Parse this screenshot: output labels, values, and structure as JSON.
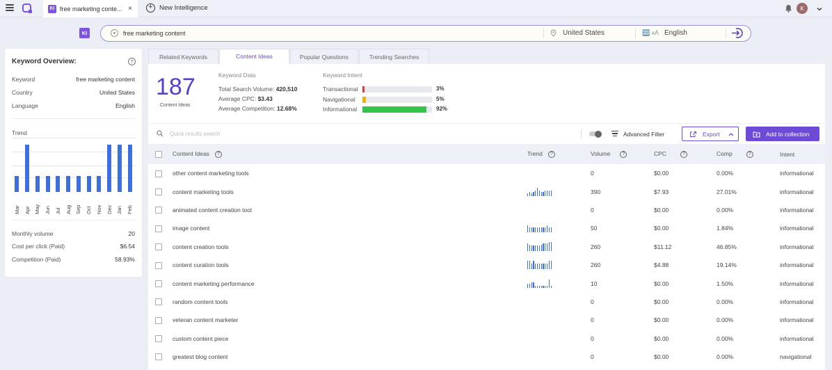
{
  "topbar": {
    "tab_badge": "KI",
    "tab_title": "free marketing conte...",
    "tab_close": "×",
    "new_tab_label": "New Intelligence",
    "avatar_letter": "K"
  },
  "search": {
    "badge": "KI",
    "query": "free marketing content",
    "country": "United States",
    "language": "English"
  },
  "overview": {
    "title": "Keyword Overview:",
    "help": "?",
    "keyword_label": "Keyword",
    "keyword_value": "free marketing content",
    "country_label": "Country",
    "country_value": "United States",
    "language_label": "Language",
    "language_value": "English",
    "trend_label": "Trend",
    "trend_months": [
      "Mar",
      "Apr",
      "May",
      "Jun",
      "Jul",
      "Aug",
      "Sep",
      "Oct",
      "Nov",
      "Dec",
      "Jan",
      "Feb"
    ],
    "trend_values": [
      1,
      3,
      1,
      1,
      1,
      1,
      1,
      1,
      1,
      3,
      3,
      3
    ],
    "trend_color": "#3d6fe0",
    "monthly_volume_label": "Monthly volume",
    "monthly_volume_value": "20",
    "cpc_label": "Cost per click (Paid)",
    "cpc_value": "$6.54",
    "competition_label": "Competition (Paid)",
    "competition_value": "58.93%"
  },
  "tabs": [
    "Related Keywords",
    "Content Ideas",
    "Popular Questions",
    "Trending Searches"
  ],
  "summary": {
    "count": "187",
    "count_label": "Content Ideas",
    "keyword_data_title": "Keyword Data",
    "total_volume_label": "Total Search Volume:",
    "total_volume_value": "420,510",
    "avg_cpc_label": "Average CPC:",
    "avg_cpc_value": "$3.43",
    "avg_comp_label": "Average Competition:",
    "avg_comp_value": "12.68%",
    "intent_title": "Keyword Intent",
    "intents": [
      {
        "label": "Transactional",
        "pct": "3%",
        "fraction": 0.03,
        "color": "#e03b3b"
      },
      {
        "label": "Navigational",
        "pct": "5%",
        "fraction": 0.05,
        "color": "#f0b400"
      },
      {
        "label": "Informational",
        "pct": "92%",
        "fraction": 0.92,
        "color": "#33c44a"
      }
    ]
  },
  "toolbar": {
    "search_placeholder": "Quick results search",
    "advanced_filter": "Advanced Filter",
    "export": "Export",
    "add_to_collection": "Add to collection"
  },
  "table": {
    "headers": {
      "idea": "Content Ideas",
      "trend": "Trend",
      "volume": "Volume",
      "cpc": "CPC",
      "comp": "Comp",
      "intent": "Intent"
    },
    "rows": [
      {
        "idea": "other content marketing tools",
        "trend": [],
        "volume": "0",
        "cpc": "$0.00",
        "comp": "0.00%",
        "intent": "informational"
      },
      {
        "idea": "content marketing tools",
        "trend": [
          3,
          4,
          3,
          4,
          6,
          9,
          6,
          4,
          4,
          6,
          6,
          6,
          6
        ],
        "volume": "390",
        "cpc": "$7.93",
        "comp": "27.01%",
        "intent": "informational"
      },
      {
        "idea": "animated content creation tool",
        "trend": [],
        "volume": "0",
        "cpc": "$0.00",
        "comp": "0.00%",
        "intent": "informational"
      },
      {
        "idea": "image content",
        "trend": [
          8,
          6,
          6,
          6,
          6,
          6,
          6,
          6,
          6,
          6,
          8,
          6,
          6
        ],
        "volume": "50",
        "cpc": "$0.00",
        "comp": "1.84%",
        "intent": "informational"
      },
      {
        "idea": "content creation tools",
        "trend": [
          8,
          7,
          6,
          6,
          6,
          6,
          6,
          7,
          8,
          8,
          8,
          10,
          10
        ],
        "volume": "260",
        "cpc": "$11.12",
        "comp": "46.85%",
        "intent": "informational"
      },
      {
        "idea": "content curation tools",
        "trend": [
          9,
          9,
          6,
          9,
          6,
          6,
          6,
          6,
          6,
          6,
          6,
          9,
          9
        ],
        "volume": "260",
        "cpc": "$4.88",
        "comp": "19.14%",
        "intent": "informational"
      },
      {
        "idea": "content marketing performance",
        "trend": [
          4,
          4,
          6,
          6,
          2,
          2,
          2,
          2,
          2,
          2,
          2,
          9,
          2
        ],
        "volume": "10",
        "cpc": "$0.00",
        "comp": "1.50%",
        "intent": "informational"
      },
      {
        "idea": "random content tools",
        "trend": [],
        "volume": "0",
        "cpc": "$0.00",
        "comp": "0.00%",
        "intent": "informational"
      },
      {
        "idea": "veteran content marketer",
        "trend": [],
        "volume": "0",
        "cpc": "$0.00",
        "comp": "0.00%",
        "intent": "informational"
      },
      {
        "idea": "custom content piece",
        "trend": [],
        "volume": "0",
        "cpc": "$0.00",
        "comp": "0.00%",
        "intent": "informational"
      },
      {
        "idea": "greatest blog content",
        "trend": [],
        "volume": "0",
        "cpc": "$0.00",
        "comp": "0.00%",
        "intent": "navigational"
      }
    ]
  },
  "colors": {
    "accent": "#6e4bd6",
    "bar": "#3d6fe0"
  }
}
